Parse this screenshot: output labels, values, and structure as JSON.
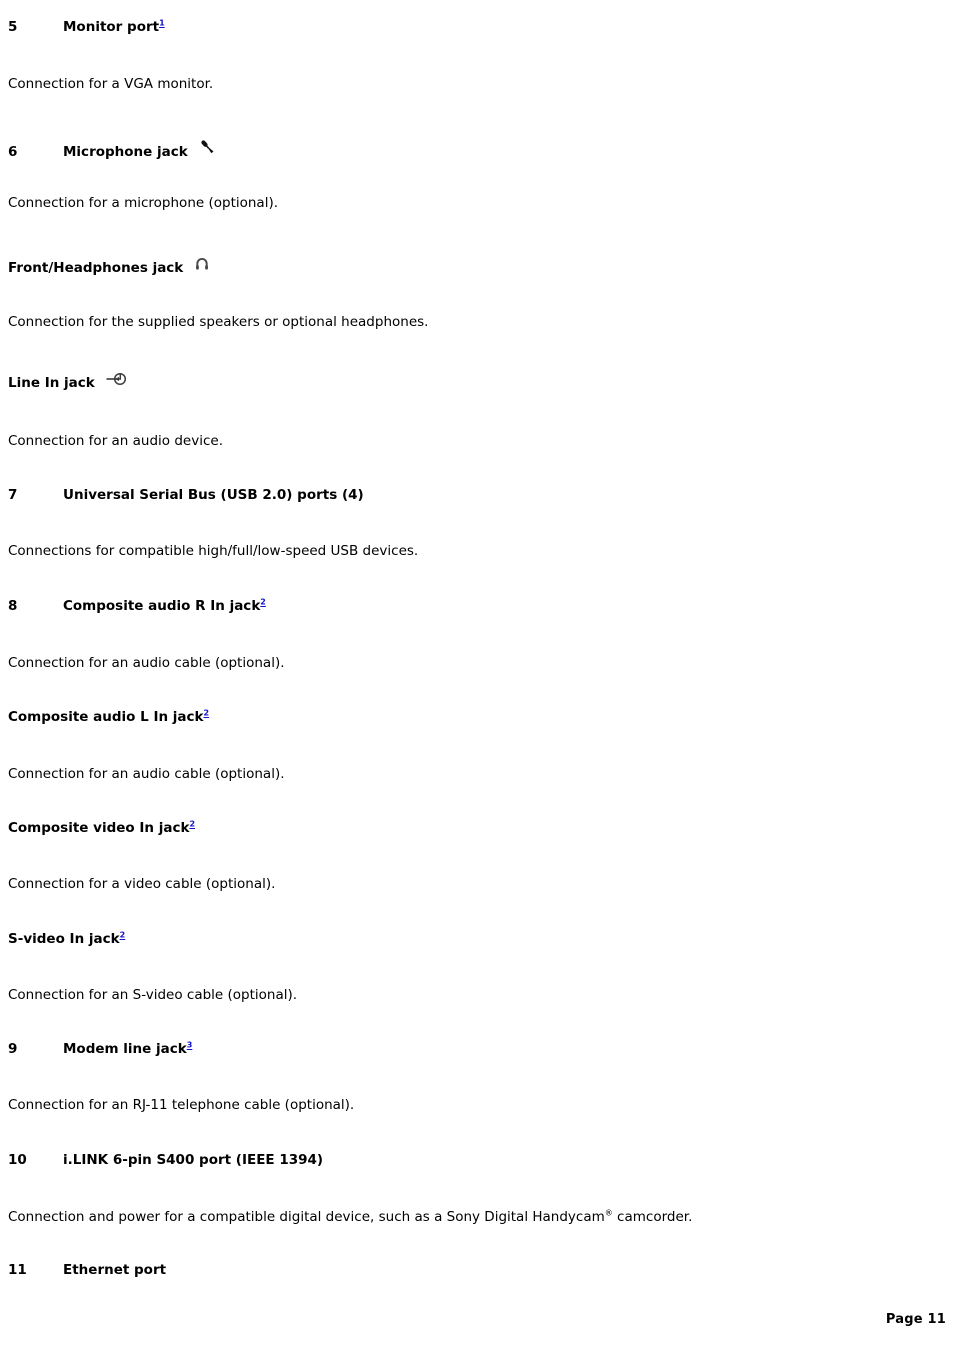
{
  "page": {
    "footer_label": "Page 11",
    "link_color": "#1111cc"
  },
  "entries": [
    {
      "num": "5",
      "label": "Monitor port",
      "footnote": "1",
      "icon": null,
      "body": "Connection for a VGA monitor."
    },
    {
      "num": "6",
      "label": "Microphone jack",
      "footnote": null,
      "icon": "microphone-icon",
      "body": "Connection for a microphone (optional)."
    },
    {
      "num": "",
      "label": "Front/Headphones jack",
      "footnote": null,
      "icon": "headphones-icon",
      "body": "Connection for the supplied speakers or optional headphones."
    },
    {
      "num": "",
      "label": "Line In jack",
      "footnote": null,
      "icon": "line-in-icon",
      "body": "Connection for an audio device."
    },
    {
      "num": "7",
      "label": "Universal Serial Bus (USB 2.0) ports (4)",
      "footnote": null,
      "icon": null,
      "body": "Connections for compatible high/full/low-speed USB devices."
    },
    {
      "num": "8",
      "label": "Composite audio R In jack",
      "footnote": "2",
      "icon": null,
      "body": "Connection for an audio cable (optional)."
    },
    {
      "num": "",
      "label": "Composite audio L In jack",
      "footnote": "2",
      "icon": null,
      "body": "Connection for an audio cable (optional)."
    },
    {
      "num": "",
      "label": "Composite video In jack",
      "footnote": "2",
      "icon": null,
      "body": "Connection for a video cable (optional)."
    },
    {
      "num": "",
      "label": "S-video In jack",
      "footnote": "2",
      "icon": null,
      "body": "Connection for an S-video cable (optional)."
    },
    {
      "num": "9",
      "label": "Modem line jack",
      "footnote": "3",
      "icon": null,
      "body": "Connection for an RJ-11 telephone cable (optional)."
    },
    {
      "num": "10",
      "label": "i.LINK 6-pin S400 port (IEEE 1394)",
      "footnote": null,
      "icon": null,
      "body_parts": {
        "before": "Connection and power for a compatible digital device, such as a Sony Digital Handycam",
        "registered": "®",
        "after": " camcorder."
      }
    },
    {
      "num": "11",
      "label": "Ethernet port",
      "footnote": null,
      "icon": null,
      "body": null
    }
  ]
}
